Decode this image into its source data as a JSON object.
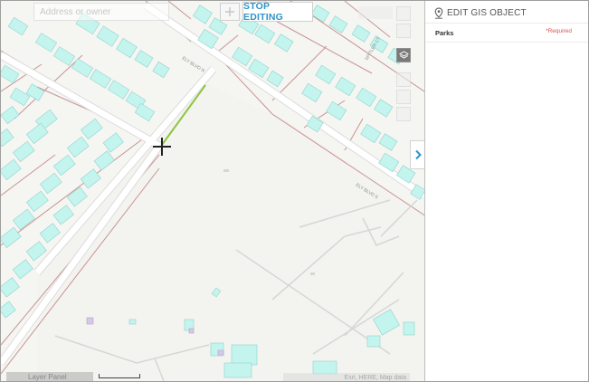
{
  "map": {
    "search_placeholder": "Address or owner",
    "toolbar": {
      "add_icon": "plus-icon",
      "stop_editing_label": "STOP EDITING"
    },
    "tool_icons": [
      "home-icon",
      "zoom-in-icon",
      "layers-icon",
      "zoom-out-icon",
      "locate-icon",
      "measure-icon"
    ],
    "street_labels": [
      "ELY BLVD N",
      "ELY BLVD S",
      "SPITLER CT"
    ],
    "bottom_left_label": "Layer Panel",
    "attribution": "Esri, HERE, Map data",
    "colors": {
      "building_fill": "#c4f4ee",
      "building_stroke": "#8fd4cc",
      "parcel_line": "#c08080",
      "road_fill": "#ffffff",
      "drawn_line": "#8cc63f",
      "accent": "#2e94c8"
    }
  },
  "panel": {
    "title": "EDIT GIS OBJECT",
    "title_icon": "map-pin-icon",
    "field": {
      "label": "Parks",
      "required_label": "*Required"
    },
    "collapse_icon": "chevron-right-icon"
  }
}
